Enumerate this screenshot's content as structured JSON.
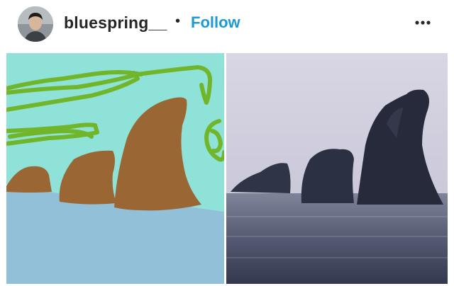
{
  "header": {
    "username": "bluespring__",
    "separator": "•",
    "follow_label": "Follow",
    "more_icon": "more-horizontal-icon",
    "avatar_icon": "profile-photo"
  },
  "post": {
    "left_image": "drawing of sea stacks",
    "right_image": "photo of sea stacks"
  },
  "colors": {
    "follow": "#1a9bd7",
    "drawing_sky": "#8fe2d8",
    "drawing_sea": "#92c0d8",
    "drawing_rock": "#996634",
    "drawing_scribble": "#71b52b"
  }
}
